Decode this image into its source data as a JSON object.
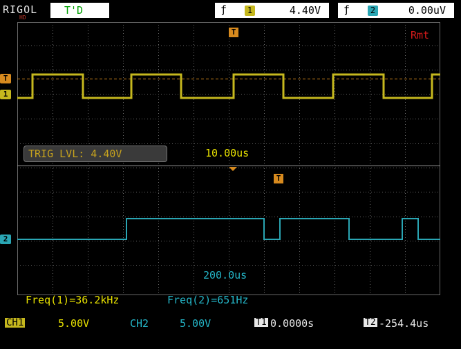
{
  "header": {
    "brand": "RIGOL",
    "brand_sub": "HD",
    "status": "T'D",
    "trig_ch1": {
      "channel": "1",
      "value": "4.40V"
    },
    "trig_ch2": {
      "channel": "2",
      "value": "0.00uV"
    }
  },
  "display": {
    "remote": "Rmt",
    "trigger_level": "TRIG LVL: 4.40V",
    "timebase_zoom": "10.00us",
    "timebase_main": "200.0us",
    "freq_ch1": "Freq(1)=36.2kHz",
    "freq_ch2": "Freq(2)=651Hz"
  },
  "markers": {
    "trigger": "T",
    "ch1": "1",
    "ch2": "2"
  },
  "footer": {
    "ch1_tag": "CH1",
    "ch1_scale": "5.00V",
    "ch2_tag": "CH2",
    "ch2_scale": "5.00V",
    "t1_tag": "T1",
    "t1_value": "0.0000s",
    "t2_tag": "T2",
    "t2_value": "-254.4us"
  },
  "colors": {
    "ch1": "#c6b81e",
    "ch2": "#2aa6b4",
    "trigger": "#d78a1e",
    "grid": "#6a6a6a",
    "background": "#000000"
  },
  "waveforms": {
    "ch1_edges_us": [
      0,
      14,
      17,
      20,
      24,
      29,
      29,
      32,
      38,
      41,
      44,
      47,
      50,
      56,
      58
    ],
    "ch2_edges_us": [
      0,
      178,
      178,
      394,
      394,
      472,
      472,
      575,
      575,
      600
    ],
    "note_units": "time in microseconds across each window"
  }
}
